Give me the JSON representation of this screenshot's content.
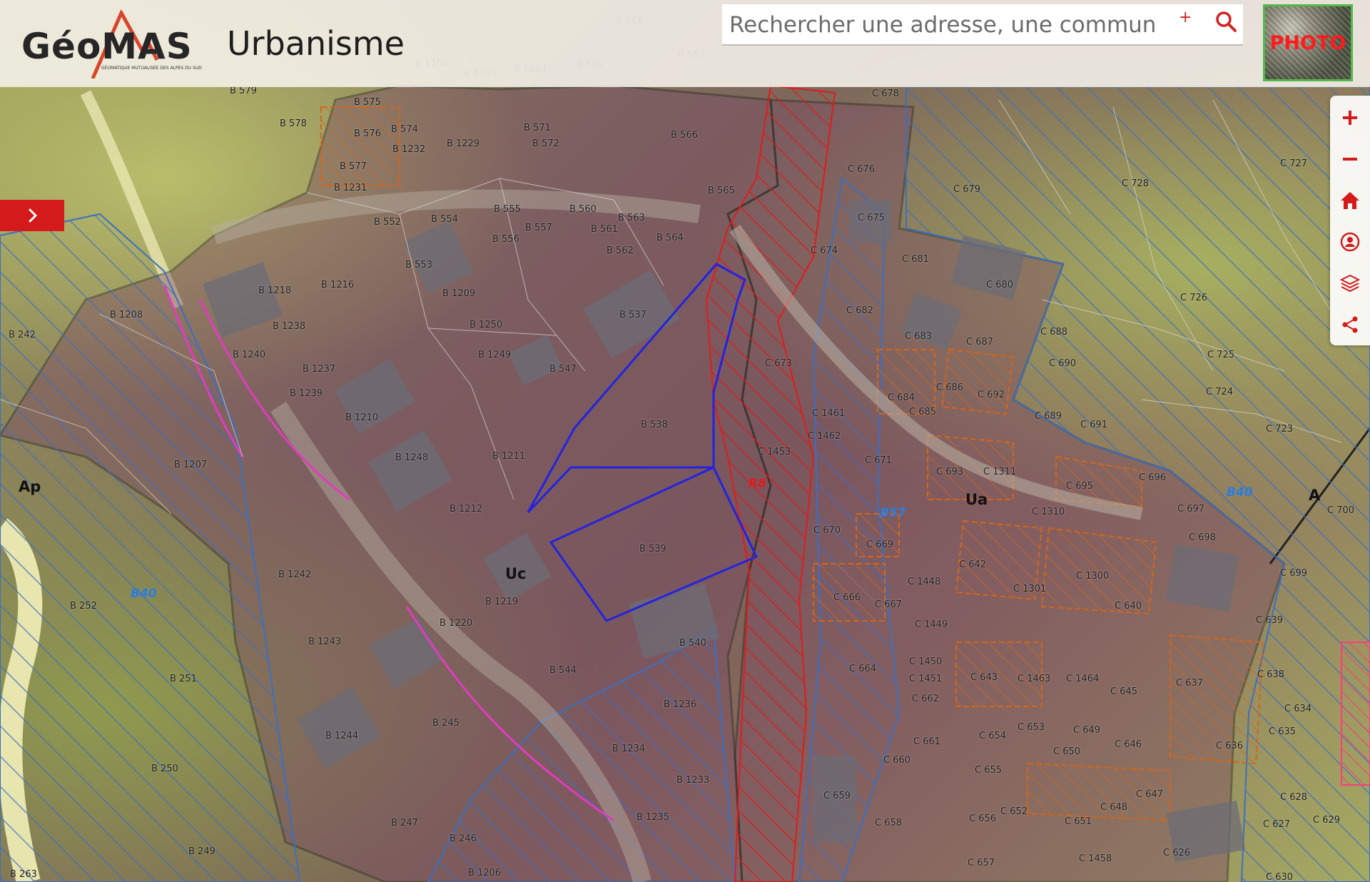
{
  "header": {
    "logo_text": "GéoMAS",
    "logo_tagline": "GÉOMATIQUE MUTUALISÉE DES ALPES DU SUD",
    "title": "Urbanisme",
    "search_placeholder": "Rechercher une adresse, une commune.",
    "search_plus": "+",
    "photo_label": "PHOTO"
  },
  "toolbar": {
    "buttons": [
      {
        "name": "zoom-in",
        "icon": "plus-icon"
      },
      {
        "name": "zoom-out",
        "icon": "minus-icon"
      },
      {
        "name": "home",
        "icon": "home-icon"
      },
      {
        "name": "locate",
        "icon": "user-location-icon"
      },
      {
        "name": "layers",
        "icon": "layers-icon"
      },
      {
        "name": "share",
        "icon": "share-icon"
      }
    ]
  },
  "map": {
    "zones": [
      {
        "id": "ap",
        "label": "Ap"
      },
      {
        "id": "uc",
        "label": "Uc"
      },
      {
        "id": "ua",
        "label": "Ua"
      },
      {
        "id": "a",
        "label": "A"
      }
    ],
    "blue_labels": [
      {
        "id": "b40-left",
        "label": "B40"
      },
      {
        "id": "b57",
        "label": "B57"
      },
      {
        "id": "b40-right",
        "label": "B40"
      }
    ],
    "red_labels": [
      {
        "id": "r8",
        "label": "R8"
      }
    ],
    "parcels": [
      {
        "id": "b578",
        "label": "B 578"
      },
      {
        "id": "b575",
        "label": "B 575"
      },
      {
        "id": "b576",
        "label": "B 576"
      },
      {
        "id": "b574",
        "label": "B 574"
      },
      {
        "id": "b1232",
        "label": "B 1232"
      },
      {
        "id": "b1229",
        "label": "B 1229"
      },
      {
        "id": "b571",
        "label": "B 571"
      },
      {
        "id": "b572",
        "label": "B 572"
      },
      {
        "id": "b566",
        "label": "B 566"
      },
      {
        "id": "b565",
        "label": "B 565"
      },
      {
        "id": "b577",
        "label": "B 577"
      },
      {
        "id": "b1231",
        "label": "B 1231"
      },
      {
        "id": "b1106",
        "label": "B 1106"
      },
      {
        "id": "b1105",
        "label": "B 1105"
      },
      {
        "id": "b1104",
        "label": "B 1104"
      },
      {
        "id": "b569",
        "label": "B 569"
      },
      {
        "id": "b568",
        "label": "B 568"
      },
      {
        "id": "b567",
        "label": "B 567"
      },
      {
        "id": "b579",
        "label": "B 579"
      },
      {
        "id": "b552",
        "label": "B 552"
      },
      {
        "id": "b554",
        "label": "B 554"
      },
      {
        "id": "b555",
        "label": "B 555"
      },
      {
        "id": "b556",
        "label": "B 556"
      },
      {
        "id": "b557",
        "label": "B 557"
      },
      {
        "id": "b560",
        "label": "B 560"
      },
      {
        "id": "b561",
        "label": "B 561"
      },
      {
        "id": "b563",
        "label": "B 563"
      },
      {
        "id": "b564",
        "label": "B 564"
      },
      {
        "id": "b562",
        "label": "B 562"
      },
      {
        "id": "b553",
        "label": "B 553"
      },
      {
        "id": "b1209",
        "label": "B 1209"
      },
      {
        "id": "b1218",
        "label": "B 1218"
      },
      {
        "id": "b1216",
        "label": "B 1216"
      },
      {
        "id": "b1208",
        "label": "B 1208"
      },
      {
        "id": "b1238",
        "label": "B 1238"
      },
      {
        "id": "b242",
        "label": "B 242"
      },
      {
        "id": "b1240",
        "label": "B 1240"
      },
      {
        "id": "b1237",
        "label": "B 1237"
      },
      {
        "id": "b1239",
        "label": "B 1239"
      },
      {
        "id": "b1250",
        "label": "B 1250"
      },
      {
        "id": "b1249",
        "label": "B 1249"
      },
      {
        "id": "b537",
        "label": "B 537"
      },
      {
        "id": "b547",
        "label": "B 547"
      },
      {
        "id": "b1210",
        "label": "B 1210"
      },
      {
        "id": "b538",
        "label": "B 538"
      },
      {
        "id": "b1248",
        "label": "B 1248"
      },
      {
        "id": "b1211",
        "label": "B 1211"
      },
      {
        "id": "b1207",
        "label": "B 1207"
      },
      {
        "id": "b1212",
        "label": "B 1212"
      },
      {
        "id": "b539",
        "label": "B 539"
      },
      {
        "id": "b1242",
        "label": "B 1242"
      },
      {
        "id": "b252",
        "label": "B 252"
      },
      {
        "id": "b1219",
        "label": "B 1219"
      },
      {
        "id": "b1220",
        "label": "B 1220"
      },
      {
        "id": "b540",
        "label": "B 540"
      },
      {
        "id": "b1243",
        "label": "B 1243"
      },
      {
        "id": "b544",
        "label": "B 544"
      },
      {
        "id": "b251",
        "label": "B 251"
      },
      {
        "id": "b1236",
        "label": "B 1236"
      },
      {
        "id": "b245",
        "label": "B 245"
      },
      {
        "id": "b1244",
        "label": "B 1244"
      },
      {
        "id": "b1234",
        "label": "B 1234"
      },
      {
        "id": "b250",
        "label": "B 250"
      },
      {
        "id": "b1233",
        "label": "B 1233"
      },
      {
        "id": "b1235",
        "label": "B 1235"
      },
      {
        "id": "b247",
        "label": "B 247"
      },
      {
        "id": "b246",
        "label": "B 246"
      },
      {
        "id": "b249",
        "label": "B 249"
      },
      {
        "id": "b1206",
        "label": "B 1206"
      },
      {
        "id": "b263",
        "label": "B 263"
      },
      {
        "id": "c678",
        "label": "C 678"
      },
      {
        "id": "c676",
        "label": "C 676"
      },
      {
        "id": "c679",
        "label": "C 679"
      },
      {
        "id": "c728",
        "label": "C 728"
      },
      {
        "id": "c727",
        "label": "C 727"
      },
      {
        "id": "c675",
        "label": "C 675"
      },
      {
        "id": "c674",
        "label": "C 674"
      },
      {
        "id": "c681",
        "label": "C 681"
      },
      {
        "id": "c680",
        "label": "C 680"
      },
      {
        "id": "c726",
        "label": "C 726"
      },
      {
        "id": "c682",
        "label": "C 682"
      },
      {
        "id": "c683",
        "label": "C 683"
      },
      {
        "id": "c687",
        "label": "C 687"
      },
      {
        "id": "c688",
        "label": "C 688"
      },
      {
        "id": "c725",
        "label": "C 725"
      },
      {
        "id": "c690",
        "label": "C 690"
      },
      {
        "id": "c673",
        "label": "C 673"
      },
      {
        "id": "c684",
        "label": "C 684"
      },
      {
        "id": "c686",
        "label": "C 686"
      },
      {
        "id": "c692",
        "label": "C 692"
      },
      {
        "id": "c724",
        "label": "C 724"
      },
      {
        "id": "c1461",
        "label": "C 1461"
      },
      {
        "id": "c685",
        "label": "C 685"
      },
      {
        "id": "c689",
        "label": "C 689"
      },
      {
        "id": "c691",
        "label": "C 691"
      },
      {
        "id": "c723",
        "label": "C 723"
      },
      {
        "id": "c1462",
        "label": "C 1462"
      },
      {
        "id": "c1453",
        "label": "C 1453"
      },
      {
        "id": "c671",
        "label": "C 671"
      },
      {
        "id": "c693",
        "label": "C 693"
      },
      {
        "id": "c1311",
        "label": "C 1311"
      },
      {
        "id": "c696",
        "label": "C 696"
      },
      {
        "id": "c695",
        "label": "C 695"
      },
      {
        "id": "c697",
        "label": "C 697"
      },
      {
        "id": "c700",
        "label": "C 700"
      },
      {
        "id": "c1310",
        "label": "C 1310"
      },
      {
        "id": "c670",
        "label": "C 670"
      },
      {
        "id": "c669",
        "label": "C 669"
      },
      {
        "id": "c698",
        "label": "C 698"
      },
      {
        "id": "c699",
        "label": "C 699"
      },
      {
        "id": "c642",
        "label": "C 642"
      },
      {
        "id": "c1300",
        "label": "C 1300"
      },
      {
        "id": "c1448",
        "label": "C 1448"
      },
      {
        "id": "c1301",
        "label": "C 1301"
      },
      {
        "id": "c666",
        "label": "C 666"
      },
      {
        "id": "c667",
        "label": "C 667"
      },
      {
        "id": "c640",
        "label": "C 640"
      },
      {
        "id": "c639",
        "label": "C 639"
      },
      {
        "id": "c1449",
        "label": "C 1449"
      },
      {
        "id": "c664",
        "label": "C 664"
      },
      {
        "id": "c1450",
        "label": "C 1450"
      },
      {
        "id": "c1451",
        "label": "C 1451"
      },
      {
        "id": "c643",
        "label": "C 643"
      },
      {
        "id": "c1463",
        "label": "C 1463"
      },
      {
        "id": "c1464",
        "label": "C 1464"
      },
      {
        "id": "c637",
        "label": "C 637"
      },
      {
        "id": "c638",
        "label": "C 638"
      },
      {
        "id": "c645",
        "label": "C 645"
      },
      {
        "id": "c662",
        "label": "C 662"
      },
      {
        "id": "c634",
        "label": "C 634"
      },
      {
        "id": "c635",
        "label": "C 635"
      },
      {
        "id": "c653",
        "label": "C 653"
      },
      {
        "id": "c649",
        "label": "C 649"
      },
      {
        "id": "c654",
        "label": "C 654"
      },
      {
        "id": "c661",
        "label": "C 661"
      },
      {
        "id": "c646",
        "label": "C 646"
      },
      {
        "id": "c636",
        "label": "C 636"
      },
      {
        "id": "c650",
        "label": "C 650"
      },
      {
        "id": "c660",
        "label": "C 660"
      },
      {
        "id": "c655",
        "label": "C 655"
      },
      {
        "id": "c647",
        "label": "C 647"
      },
      {
        "id": "c659",
        "label": "C 659"
      },
      {
        "id": "c648",
        "label": "C 648"
      },
      {
        "id": "c628",
        "label": "C 628"
      },
      {
        "id": "c652",
        "label": "C 652"
      },
      {
        "id": "c656",
        "label": "C 656"
      },
      {
        "id": "c651",
        "label": "C 651"
      },
      {
        "id": "c629",
        "label": "C 629"
      },
      {
        "id": "c658",
        "label": "C 658"
      },
      {
        "id": "c627",
        "label": "C 627"
      },
      {
        "id": "c1458",
        "label": "C 1458"
      },
      {
        "id": "c626",
        "label": "C 626"
      },
      {
        "id": "c657",
        "label": "C 657"
      },
      {
        "id": "c630",
        "label": "C 630"
      }
    ]
  }
}
